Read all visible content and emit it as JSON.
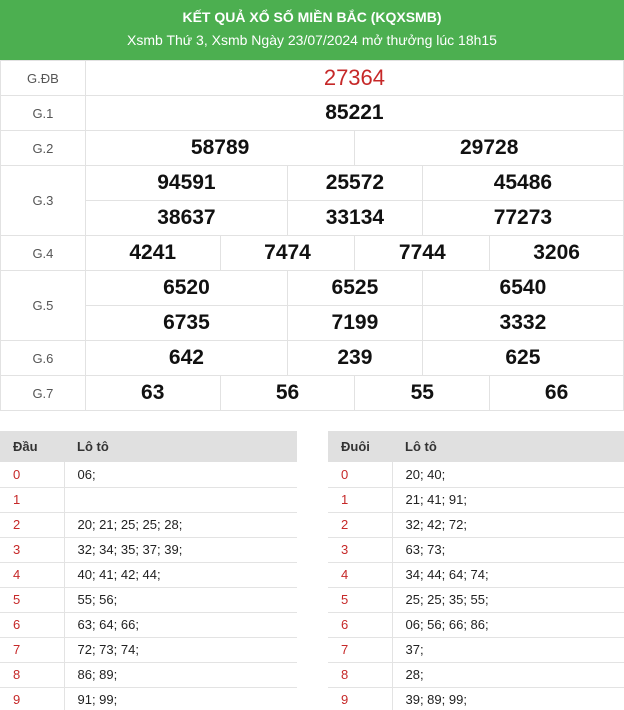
{
  "header": {
    "title": "KẾT QUẢ XỔ SỐ MIỀN BẮC (KQXSMB)",
    "subtitle": "Xsmb Thứ 3, Xsmb Ngày 23/07/2024 mở thưởng lúc 18h15"
  },
  "prizes": {
    "gdb": {
      "label": "G.ĐB",
      "numbers": [
        "27364"
      ]
    },
    "g1": {
      "label": "G.1",
      "numbers": [
        "85221"
      ]
    },
    "g2": {
      "label": "G.2",
      "numbers": [
        "58789",
        "29728"
      ]
    },
    "g3": {
      "label": "G.3",
      "numbers": [
        "94591",
        "25572",
        "45486",
        "38637",
        "33134",
        "77273"
      ]
    },
    "g4": {
      "label": "G.4",
      "numbers": [
        "4241",
        "7474",
        "7744",
        "3206"
      ]
    },
    "g5": {
      "label": "G.5",
      "numbers": [
        "6520",
        "6525",
        "6540",
        "6735",
        "7199",
        "3332"
      ]
    },
    "g6": {
      "label": "G.6",
      "numbers": [
        "642",
        "239",
        "625"
      ]
    },
    "g7": {
      "label": "G.7",
      "numbers": [
        "63",
        "56",
        "55",
        "66"
      ]
    }
  },
  "dau": {
    "col1": "Đầu",
    "col2": "Lô tô",
    "rows": [
      {
        "k": "0",
        "v": "06;"
      },
      {
        "k": "1",
        "v": ""
      },
      {
        "k": "2",
        "v": "20; 21; 25; 25; 28;"
      },
      {
        "k": "3",
        "v": "32; 34; 35; 37; 39;"
      },
      {
        "k": "4",
        "v": "40; 41; 42; 44;"
      },
      {
        "k": "5",
        "v": "55; 56;"
      },
      {
        "k": "6",
        "v": "63; 64; 66;"
      },
      {
        "k": "7",
        "v": "72; 73; 74;"
      },
      {
        "k": "8",
        "v": "86; 89;"
      },
      {
        "k": "9",
        "v": "91; 99;"
      }
    ]
  },
  "duoi": {
    "col1": "Đuôi",
    "col2": "Lô tô",
    "rows": [
      {
        "k": "0",
        "v": "20; 40;"
      },
      {
        "k": "1",
        "v": "21; 41; 91;"
      },
      {
        "k": "2",
        "v": "32; 42; 72;"
      },
      {
        "k": "3",
        "v": "63; 73;"
      },
      {
        "k": "4",
        "v": "34; 44; 64; 74;"
      },
      {
        "k": "5",
        "v": "25; 25; 35; 55;"
      },
      {
        "k": "6",
        "v": "06; 56; 66; 86;"
      },
      {
        "k": "7",
        "v": "37;"
      },
      {
        "k": "8",
        "v": "28;"
      },
      {
        "k": "9",
        "v": "39; 89; 99;"
      }
    ]
  },
  "colors": {
    "header_bg": "#4caf50",
    "accent_red": "#c62828",
    "table_header_bg": "#e0e0e0"
  }
}
